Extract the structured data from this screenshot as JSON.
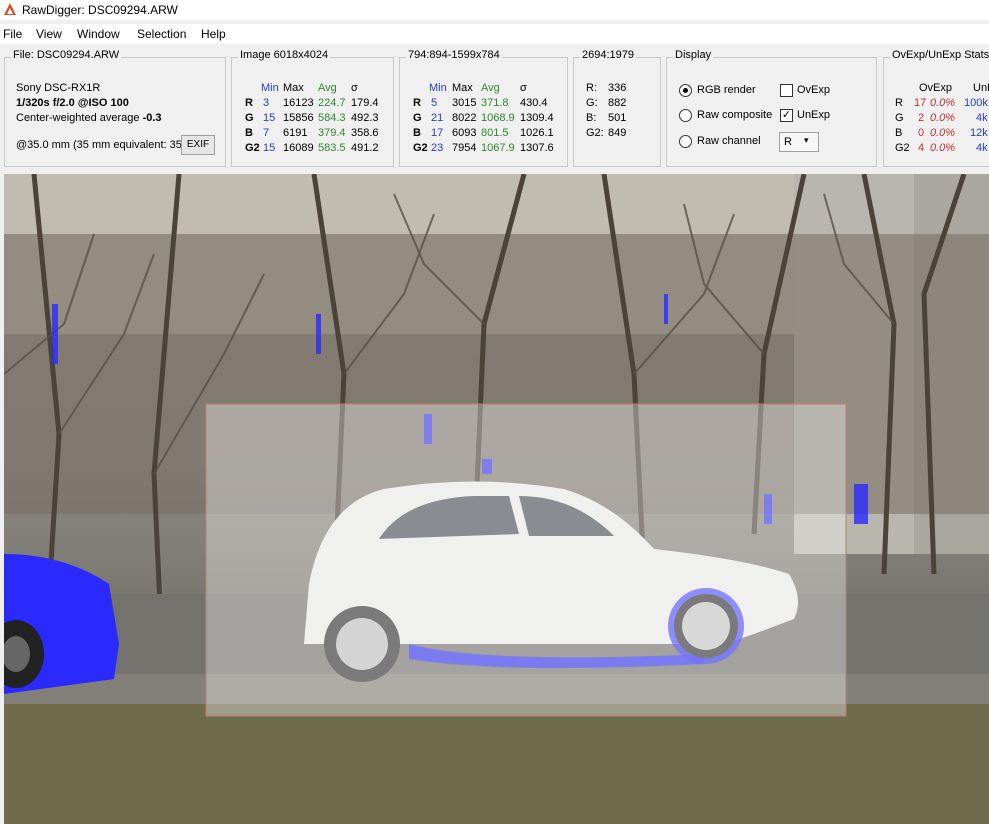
{
  "window": {
    "title": "RawDigger: DSC09294.ARW"
  },
  "menu": [
    "File",
    "View",
    "Window",
    "Selection",
    "Help"
  ],
  "file_panel": {
    "title": "File: DSC09294.ARW",
    "camera": "Sony DSC-RX1R",
    "exposure": "1/320s f/2.0 @ISO 100",
    "metering_label": "Center-weighted average",
    "metering_value": "-0.3",
    "focal": "@35.0 mm (35 mm equivalent: 35.",
    "exif_button": "EXIF"
  },
  "image_panel": {
    "title": "Image 6018x4024",
    "headers": {
      "min": "Min",
      "max": "Max",
      "avg": "Avg",
      "sigma": "σ"
    },
    "rows": [
      {
        "ch": "R",
        "min": "3",
        "max": "16123",
        "avg": "224.7",
        "sigma": "179.4"
      },
      {
        "ch": "G",
        "min": "15",
        "max": "15856",
        "avg": "584.3",
        "sigma": "492.3"
      },
      {
        "ch": "B",
        "min": "7",
        "max": "6191",
        "avg": "379.4",
        "sigma": "358.6"
      },
      {
        "ch": "G2",
        "min": "15",
        "max": "16089",
        "avg": "583.5",
        "sigma": "491.2"
      }
    ]
  },
  "selection_panel": {
    "title": "794:894-1599x784",
    "headers": {
      "min": "Min",
      "max": "Max",
      "avg": "Avg",
      "sigma": "σ"
    },
    "rows": [
      {
        "ch": "R",
        "min": "5",
        "max": "3015",
        "avg": "371.8",
        "sigma": "430.4"
      },
      {
        "ch": "G",
        "min": "21",
        "max": "8022",
        "avg": "1068.9",
        "sigma": "1309.4"
      },
      {
        "ch": "B",
        "min": "17",
        "max": "6093",
        "avg": "801.5",
        "sigma": "1026.1"
      },
      {
        "ch": "G2",
        "min": "23",
        "max": "7954",
        "avg": "1067.9",
        "sigma": "1307.6"
      }
    ]
  },
  "pixel_panel": {
    "title": "2694:1979",
    "rows": [
      {
        "label": "R:",
        "value": "336"
      },
      {
        "label": "G:",
        "value": "882"
      },
      {
        "label": "B:",
        "value": "501"
      },
      {
        "label": "G2:",
        "value": "849"
      }
    ]
  },
  "display_panel": {
    "title": "Display",
    "rgb_render": "RGB render",
    "raw_composite": "Raw composite",
    "raw_channel": "Raw channel",
    "ovexp": "OvExp",
    "unexp": "UnExp",
    "channel_selected": "R",
    "ovexp_checked": false,
    "unexp_checked": true
  },
  "stats_panel": {
    "title": "OvExp/UnExp Stats",
    "col_ovexp": "OvExp",
    "col_unexp": "UnE",
    "rows": [
      {
        "ch": "R",
        "count": "17",
        "pct": "0.0%",
        "unexp": "100k"
      },
      {
        "ch": "G",
        "count": "2",
        "pct": "0.0%",
        "unexp": "4k"
      },
      {
        "ch": "B",
        "count": "0",
        "pct": "0.0%",
        "unexp": "12k"
      },
      {
        "ch": "G2",
        "count": "4",
        "pct": "0.0%",
        "unexp": "4k"
      }
    ]
  },
  "colors": {
    "accent_blue": "#2b3bd0",
    "avg_green": "#2e8b2e",
    "ovexp_red": "#d03030",
    "underexposure_overlay": "#2a2aff"
  }
}
